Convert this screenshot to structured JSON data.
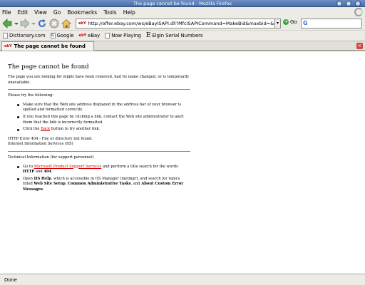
{
  "window": {
    "title": "The page cannot be found - Mozilla Firefox"
  },
  "menubar": {
    "items": [
      {
        "label": "File"
      },
      {
        "label": "Edit"
      },
      {
        "label": "View"
      },
      {
        "label": "Go"
      },
      {
        "label": "Bookmarks"
      },
      {
        "label": "Tools"
      },
      {
        "label": "Help"
      }
    ]
  },
  "navbar": {
    "url": "http://offer.ebay.com/ws/eBayISAPI.dll?MfcISAPICommand=MakeBid&maxbid=&ite",
    "favicon": "ebY",
    "go_label": "Go"
  },
  "bookmarks": {
    "items": [
      {
        "label": "Dictionary.com",
        "icon": "page-icon"
      },
      {
        "label": "Google",
        "icon": "google-icon"
      },
      {
        "label": "eBay",
        "icon": "ebay-icon",
        "mark": "ebY"
      },
      {
        "label": "Now Playing",
        "icon": "page-icon"
      },
      {
        "label": "Elgin Serial Numbers",
        "icon": "elgin-icon",
        "mark": "E"
      }
    ]
  },
  "tab": {
    "label": "The page cannot be found",
    "mark": "ebY"
  },
  "page": {
    "heading": "The page cannot be found",
    "intro": "The page you are looking for might have been removed, had its name changed, or is temporarily unavailable.",
    "try_heading": "Please try the following:",
    "try_items": [
      {
        "text": "Make sure that the Web site address displayed in the address bar of your browser is spelled and formatted correctly."
      },
      {
        "text": "If you reached this page by clicking a link, contact the Web site administrator to alert them that the link is incorrectly formatted."
      },
      {
        "pre": "Click the ",
        "link": "Back",
        "post": " button to try another link."
      }
    ],
    "error_line1": "HTTP Error 404 - File or directory not found.",
    "error_line2": "Internet Information Services (IIS)",
    "tech_heading": "Technical Information (for support personnel)",
    "tech_items": [
      {
        "pre": "Go to ",
        "link": "Microsoft Product Support Services",
        "mid": " and perform a title search for the words ",
        "b1": "HTTP",
        "mid2": " and ",
        "b2": "404",
        "post": "."
      },
      {
        "pre": "Open ",
        "b1": "IIS Help",
        "mid": ", which is accessible in IIS Manager (inetmgr), and search for topics titled ",
        "b2": "Web Site Setup",
        "mid2": ", ",
        "b3": "Common Administrative Tasks",
        "mid3": ", and ",
        "b4": "About Custom Error Messages",
        "post": "."
      }
    ]
  },
  "status": {
    "text": "Done"
  }
}
